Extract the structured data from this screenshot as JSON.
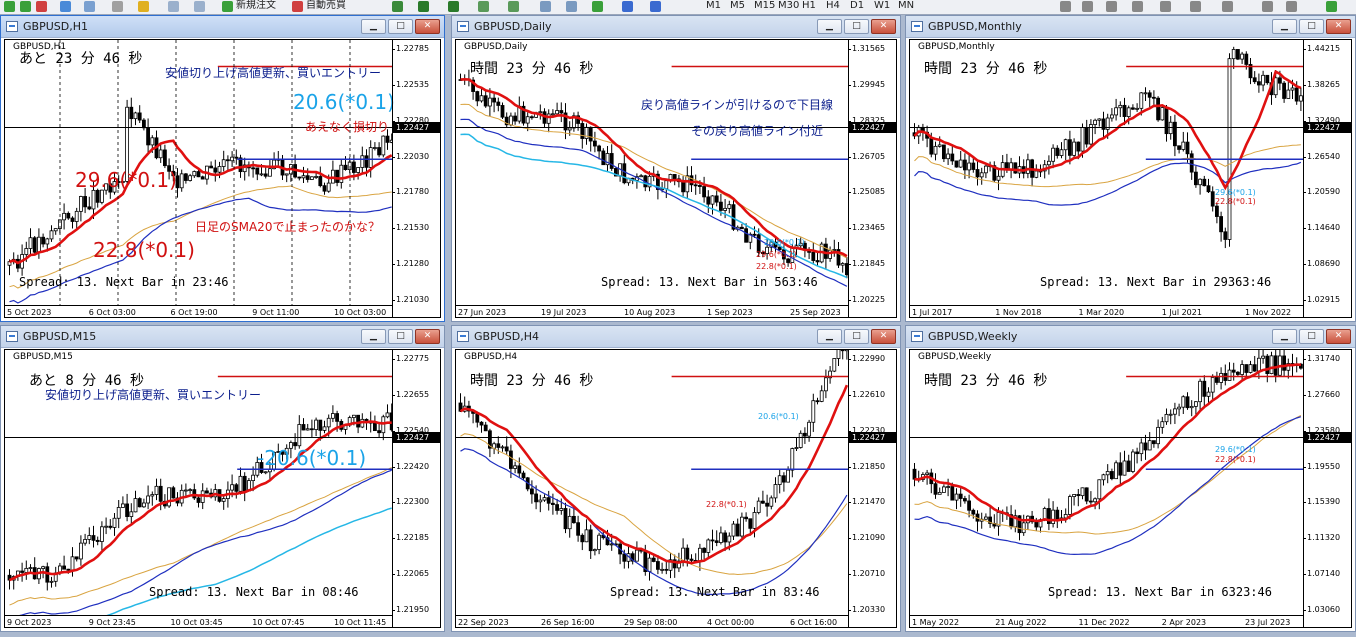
{
  "toolbar": {
    "new_order": "新規注文",
    "auto_trade": "自動売買",
    "timeframes": [
      "M1",
      "M5",
      "M15",
      "M30",
      "H1",
      "H4",
      "D1",
      "W1",
      "MN"
    ]
  },
  "colors": {
    "bull": "#000000",
    "bear": "#000000",
    "sma_red": "#e01010",
    "ma_blue": "#1f2fbf",
    "ma_orange": "#d9a441",
    "ma_cyan": "#26b7e6",
    "accent": "#2f6fd0"
  },
  "windows": [
    {
      "id": "h1",
      "active": true,
      "title": "GBPUSD,H1",
      "symbol": "GBPUSD,H1",
      "timer": "あと 23 分 46 秒",
      "spread": "Spread:  13.  Next Bar in 23:46",
      "notes": [
        {
          "text": "安値切り上げ高値更新、買いエントリー",
          "style": "note"
        },
        {
          "text": "20.6(*0.1)",
          "style": "big cyan"
        },
        {
          "text": "あえなく損切り",
          "style": "note red"
        },
        {
          "text": "29.6(*0.1)",
          "style": "big red"
        },
        {
          "text": "日足のSMA20で止まったのかな？",
          "style": "note red"
        },
        {
          "text": "22.8(*0.1)",
          "style": "big red"
        }
      ],
      "yticks": [
        "1.22785",
        "1.22535",
        "1.22280",
        "1.22030",
        "1.21780",
        "1.21530",
        "1.21280",
        "1.21030"
      ],
      "price": "1.22427",
      "xticks": [
        "5 Oct 2023",
        "6 Oct 03:00",
        "6 Oct 19:00",
        "9 Oct 11:00",
        "10 Oct 03:00"
      ]
    },
    {
      "id": "d1",
      "active": false,
      "title": "GBPUSD,Daily",
      "symbol": "GBPUSD,Daily",
      "timer": "時間 23 分 46 秒",
      "spread": "Spread:  13.  Next Bar in 563:46",
      "notes": [
        {
          "text": "戻り高値ラインが引けるので下目線",
          "style": "note"
        },
        {
          "text": "その戻り高値ライン付近",
          "style": "note"
        },
        {
          "text": "20.6(*0.1)",
          "style": "small cyan"
        },
        {
          "text": "29.6(*0.1)",
          "style": "small red"
        },
        {
          "text": "22.8(*0.1)",
          "style": "small red"
        }
      ],
      "yticks": [
        "1.31565",
        "1.29945",
        "1.28325",
        "1.26705",
        "1.25085",
        "1.23465",
        "1.21845",
        "1.20225"
      ],
      "price": "1.22427",
      "xticks": [
        "27 Jun 2023",
        "19 Jul 2023",
        "10 Aug 2023",
        "1 Sep 2023",
        "25 Sep 2023"
      ]
    },
    {
      "id": "mn",
      "active": false,
      "title": "GBPUSD,Monthly",
      "symbol": "GBPUSD,Monthly",
      "timer": "時間 23 分 46 秒",
      "spread": "Spread:  13.  Next Bar in 29363:46",
      "notes": [
        {
          "text": "29.6(*0.1)",
          "style": "small cyan"
        },
        {
          "text": "22.8(*0.1)",
          "style": "small red"
        }
      ],
      "yticks": [
        "1.44215",
        "1.38265",
        "1.32490",
        "1.26540",
        "1.20590",
        "1.14640",
        "1.08690",
        "1.02915"
      ],
      "price": "1.22427",
      "xticks": [
        "1 Jul 2017",
        "1 Nov 2018",
        "1 Mar 2020",
        "1 Jul 2021",
        "1 Nov 2022"
      ]
    },
    {
      "id": "m15",
      "active": false,
      "title": "GBPUSD,M15",
      "symbol": "GBPUSD,M15",
      "timer": "あと 8 分 46 秒",
      "spread": "Spread:  13.  Next Bar in 08:46",
      "notes": [
        {
          "text": "安値切り上げ高値更新、買いエントリー",
          "style": "note"
        },
        {
          "text": "-20.6(*0.1)",
          "style": "big cyan"
        }
      ],
      "yticks": [
        "1.22775",
        "1.22655",
        "1.22540",
        "1.22420",
        "1.22300",
        "1.22185",
        "1.22065",
        "1.21950"
      ],
      "price": "1.22427",
      "xticks": [
        "9 Oct 2023",
        "9 Oct 23:45",
        "10 Oct 03:45",
        "10 Oct 07:45",
        "10 Oct 11:45"
      ]
    },
    {
      "id": "h4",
      "active": false,
      "title": "GBPUSD,H4",
      "symbol": "GBPUSD,H4",
      "timer": "時間 23 分 46 秒",
      "spread": "Spread:  13.  Next Bar in 83:46",
      "notes": [
        {
          "text": "20.6(*0.1)",
          "style": "small cyan"
        },
        {
          "text": "22.8(*0.1)",
          "style": "small red"
        }
      ],
      "yticks": [
        "1.22990",
        "1.22610",
        "1.22230",
        "1.21850",
        "1.21470",
        "1.21090",
        "1.20710",
        "1.20330"
      ],
      "price": "1.22427",
      "xticks": [
        "22 Sep 2023",
        "26 Sep 16:00",
        "29 Sep 08:00",
        "4 Oct 00:00",
        "6 Oct 16:00"
      ]
    },
    {
      "id": "w1",
      "active": false,
      "title": "GBPUSD,Weekly",
      "symbol": "GBPUSD,Weekly",
      "timer": "時間 23 分 46 秒",
      "spread": "Spread:  13.  Next Bar in 6323:46",
      "notes": [
        {
          "text": "29.6(*0.1)",
          "style": "small cyan"
        },
        {
          "text": "22.8(*0.1)",
          "style": "small red"
        }
      ],
      "yticks": [
        "1.31740",
        "1.27660",
        "1.23580",
        "1.19550",
        "1.15390",
        "1.11320",
        "1.07140",
        "1.03060"
      ],
      "price": "1.22427",
      "xticks": [
        "1 May 2022",
        "21 Aug 2022",
        "11 Dec 2022",
        "2 Apr 2023",
        "23 Jul 2023"
      ]
    }
  ]
}
